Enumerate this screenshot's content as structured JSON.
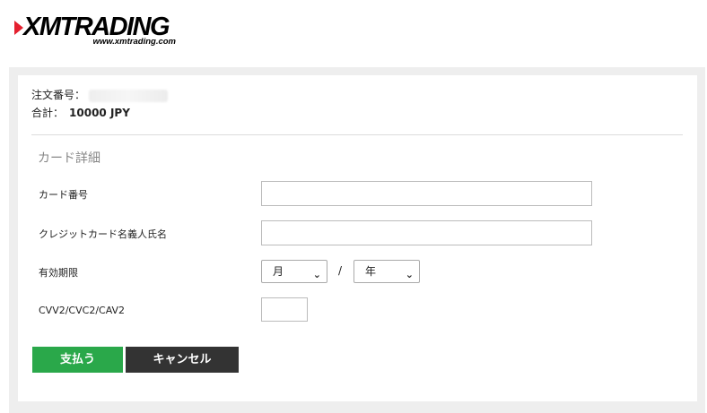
{
  "logo": {
    "name": "XMTRADING",
    "sub": "www.xmtrading.com"
  },
  "order": {
    "number_label": "注文番号：",
    "total_label": "合計：",
    "total_value": "10000 JPY"
  },
  "card": {
    "section_title": "カード詳細",
    "number_label": "カード番号",
    "holder_label": "クレジットカード名義人氏名",
    "expiry_label": "有効期限",
    "month_value": "月",
    "year_value": "年",
    "separator": "/",
    "cvv_label": "CVV2/CVC2/CAV2"
  },
  "buttons": {
    "pay": "支払う",
    "cancel": "キャンセル"
  },
  "colors": {
    "pay": "#2aa84a",
    "cancel": "#333333",
    "brand_red": "#e4202f"
  }
}
